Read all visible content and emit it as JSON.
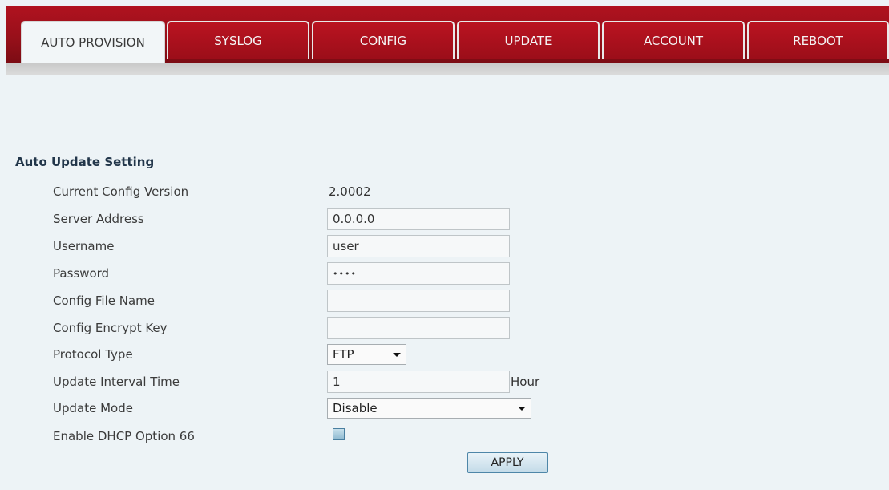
{
  "tabs": [
    {
      "label": "AUTO PROVISION",
      "active": true
    },
    {
      "label": "SYSLOG"
    },
    {
      "label": "CONFIG"
    },
    {
      "label": "UPDATE"
    },
    {
      "label": "ACCOUNT"
    },
    {
      "label": "REBOOT"
    }
  ],
  "colors": {
    "tab_red": "#a8111d",
    "background": "#edf3f6"
  },
  "section": {
    "title": "Auto Update Setting"
  },
  "form": {
    "current_config_version": {
      "label": "Current Config Version",
      "value": "2.0002"
    },
    "server_address": {
      "label": "Server Address",
      "value": "0.0.0.0"
    },
    "username": {
      "label": "Username",
      "value": "user"
    },
    "password": {
      "label": "Password",
      "value": "••••"
    },
    "config_file_name": {
      "label": "Config File Name",
      "value": ""
    },
    "config_encrypt_key": {
      "label": "Config Encrypt Key",
      "value": ""
    },
    "protocol_type": {
      "label": "Protocol Type",
      "value": "FTP"
    },
    "update_interval_time": {
      "label": "Update Interval Time",
      "value": "1",
      "unit": "Hour"
    },
    "update_mode": {
      "label": "Update Mode",
      "value": "Disable"
    },
    "enable_dhcp_option_66": {
      "label": "Enable DHCP Option 66",
      "checked": false
    }
  },
  "apply_label": "APPLY"
}
